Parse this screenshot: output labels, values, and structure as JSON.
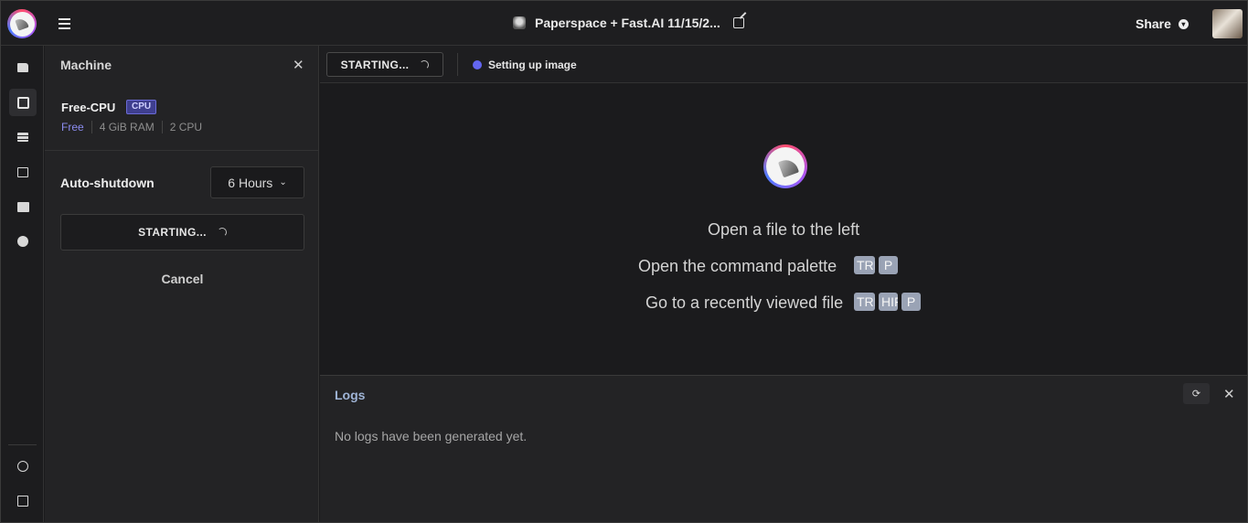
{
  "topbar": {
    "notebook_title": "Paperspace + Fast.AI 11/15/2...",
    "share_label": "Share"
  },
  "rail": {
    "items": [
      "folder-icon",
      "chip-icon",
      "stack-icon",
      "chart-icon",
      "terminal-icon",
      "clock-icon",
      "output-icon",
      "document-icon"
    ]
  },
  "machine_panel": {
    "title": "Machine",
    "machine_name": "Free-CPU",
    "badge": "CPU",
    "tier": "Free",
    "ram": "4 GiB RAM",
    "cpus": "2 CPU",
    "autoshutdown_label": "Auto-shutdown",
    "autoshutdown_value": "6 Hours",
    "start_button": "STARTING...",
    "cancel_button": "Cancel"
  },
  "status": {
    "state": "STARTING...",
    "message": "Setting up image",
    "dot_color": "#6366f1"
  },
  "editor": {
    "hint_open_file": "Open a file to the left",
    "hint_command_palette": "Open the command palette",
    "hint_recent_file": "Go to a recently viewed file",
    "keys_command_palette": [
      "TRL",
      "P"
    ],
    "keys_recent_file": [
      "TRL",
      "HIFT",
      "P"
    ]
  },
  "logs": {
    "title": "Logs",
    "empty_message": "No logs have been generated yet."
  }
}
